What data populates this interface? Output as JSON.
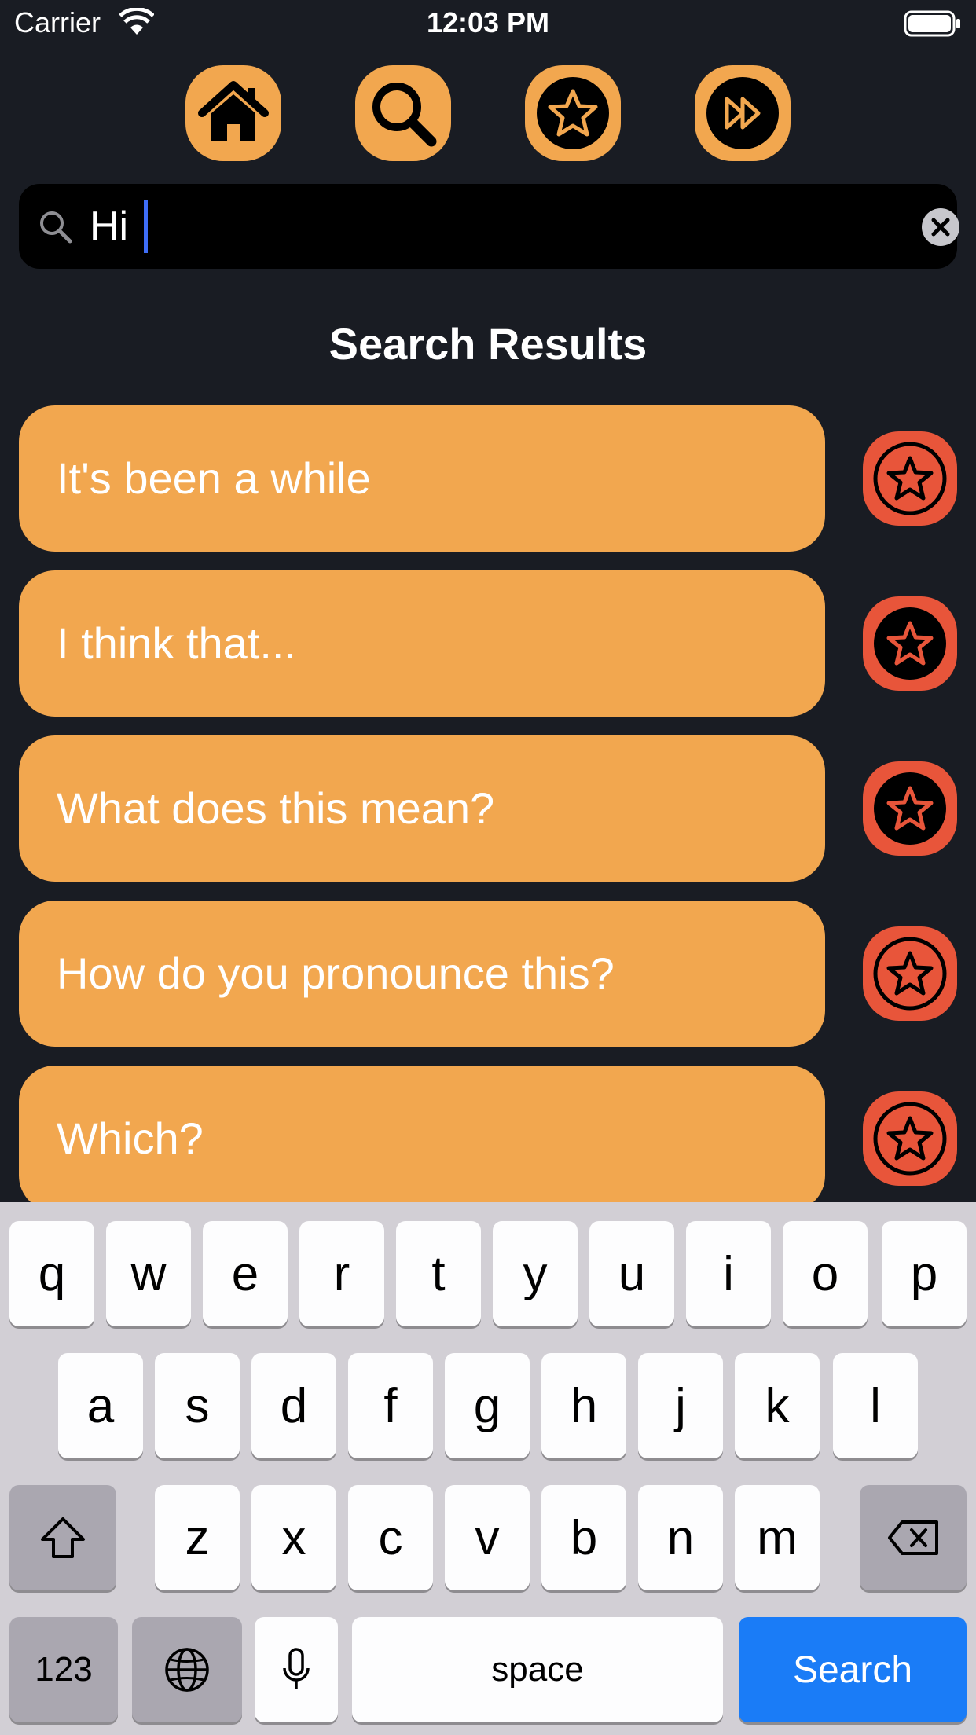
{
  "status_bar": {
    "carrier": "Carrier",
    "time": "12:03 PM",
    "icons": [
      "wifi-icon",
      "battery-icon"
    ]
  },
  "nav": {
    "buttons": [
      {
        "name": "home",
        "icon": "home-icon"
      },
      {
        "name": "search",
        "icon": "search-icon"
      },
      {
        "name": "favorites",
        "icon": "star-icon"
      },
      {
        "name": "next",
        "icon": "fast-forward-icon"
      }
    ]
  },
  "search": {
    "value": "Hi",
    "icon": "search-icon",
    "clear_icon": "clear-icon"
  },
  "results": {
    "title": "Search Results",
    "items": [
      {
        "label": "It's been a while",
        "favorited": false
      },
      {
        "label": "I think that...",
        "favorited": true
      },
      {
        "label": "What does this mean?",
        "favorited": true
      },
      {
        "label": "How do you pronounce this?",
        "favorited": false
      },
      {
        "label": "Which?",
        "favorited": false
      }
    ]
  },
  "keyboard": {
    "row1": [
      "q",
      "w",
      "e",
      "r",
      "t",
      "y",
      "u",
      "i",
      "o",
      "p"
    ],
    "row2": [
      "a",
      "s",
      "d",
      "f",
      "g",
      "h",
      "j",
      "k",
      "l"
    ],
    "row3": [
      "z",
      "x",
      "c",
      "v",
      "b",
      "n",
      "m"
    ],
    "numbers_label": "123",
    "space_label": "space",
    "return_label": "Search"
  },
  "colors": {
    "background": "#191c23",
    "accent_orange": "#f2a74f",
    "favorite_red": "#e8553a",
    "keyboard_blue": "#1a7cf7"
  }
}
